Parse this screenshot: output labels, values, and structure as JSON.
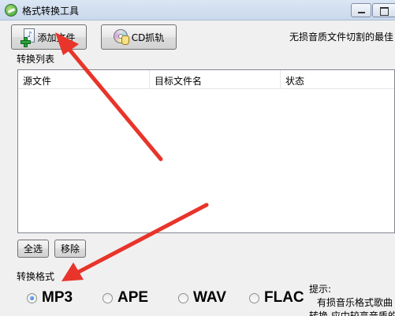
{
  "window": {
    "title": "格式转换工具"
  },
  "toolbar": {
    "add_file_label": "添加文件",
    "cd_rip_label": "CD抓轨",
    "note": "无损音质文件切割的最佳"
  },
  "file_list": {
    "group_label": "转换列表",
    "columns": [
      "源文件",
      "目标文件名",
      "状态"
    ],
    "rows": []
  },
  "list_actions": {
    "select_all_label": "全选",
    "remove_label": "移除"
  },
  "format": {
    "group_label": "转换格式",
    "options": [
      "MP3",
      "APE",
      "WAV",
      "FLAC"
    ],
    "selected": "MP3"
  },
  "tip": {
    "title": "提示:",
    "line1": "有损音乐格式歌曲",
    "line2": "转换 应中较高音质的"
  },
  "colors": {
    "annotation_arrow": "#e8342a",
    "radio_accent": "#1d5fc7"
  },
  "icons": {
    "app": "app-icon",
    "add_file": "add-file-icon",
    "cd": "cd-icon"
  }
}
